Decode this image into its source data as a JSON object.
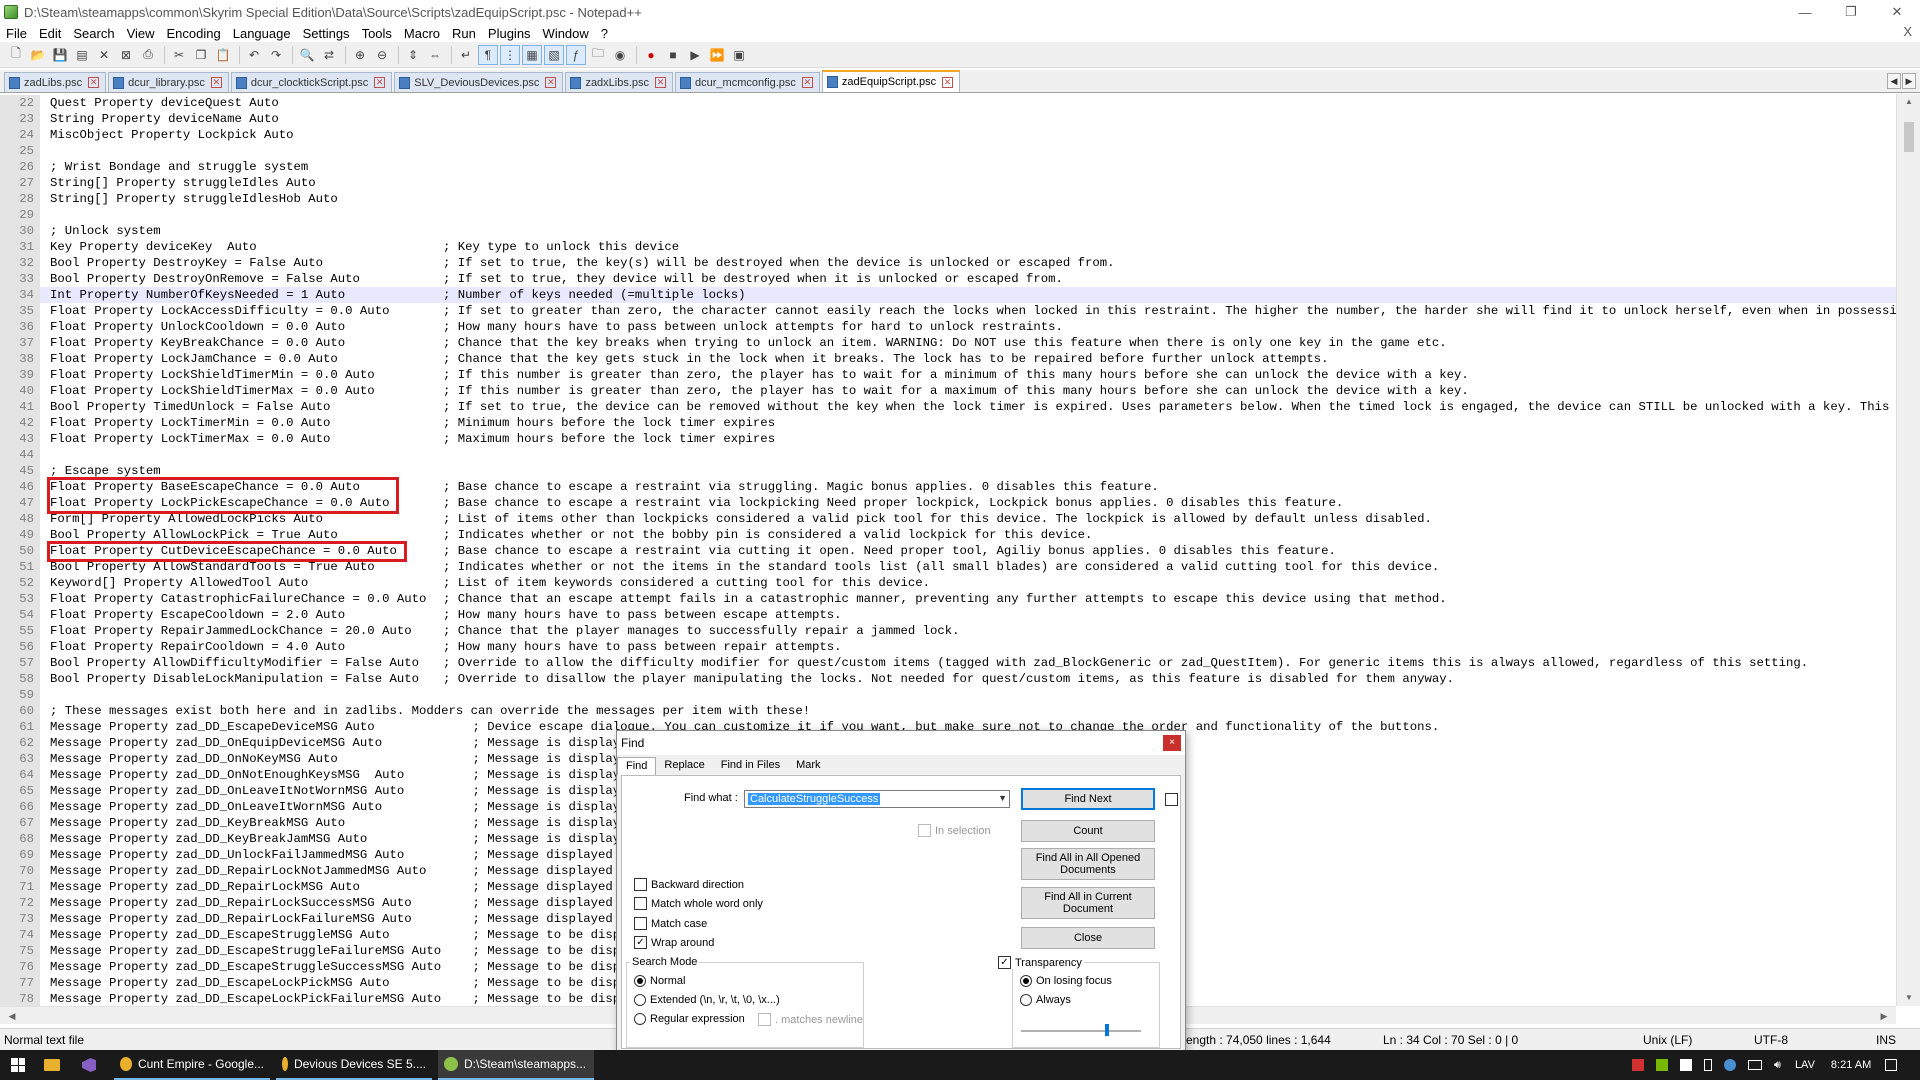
{
  "window": {
    "title": "D:\\Steam\\steamapps\\common\\Skyrim Special Edition\\Data\\Source\\Scripts\\zadEquipScript.psc - Notepad++",
    "minimize": "—",
    "restore": "❐",
    "close": "✕"
  },
  "menu": [
    "File",
    "Edit",
    "Search",
    "View",
    "Encoding",
    "Language",
    "Settings",
    "Tools",
    "Macro",
    "Run",
    "Plugins",
    "Window",
    "?"
  ],
  "menu_close": "X",
  "toolbar_icons": [
    "new-file-icon",
    "open-file-icon",
    "save-icon",
    "save-all-icon",
    "close-icon",
    "close-all-icon",
    "print-icon",
    "cut-icon",
    "copy-icon",
    "paste-icon",
    "undo-icon",
    "redo-icon",
    "find-icon",
    "replace-icon",
    "zoom-in-icon",
    "zoom-out-icon",
    "sync-vertical-icon",
    "sync-horizontal-icon",
    "word-wrap-icon",
    "show-all-chars-icon",
    "indent-guide-icon",
    "udl-icon",
    "doc-map-icon",
    "function-list-icon",
    "folder-workspace-icon",
    "monitoring-icon",
    "record-macro-icon",
    "stop-macro-icon",
    "play-macro-icon",
    "run-macro-multiple-icon",
    "save-macro-icon"
  ],
  "tabs": [
    {
      "label": "zadLibs.psc",
      "active": false
    },
    {
      "label": "dcur_library.psc",
      "active": false
    },
    {
      "label": "dcur_clocktickScript.psc",
      "active": false
    },
    {
      "label": "SLV_DeviousDevices.psc",
      "active": false
    },
    {
      "label": "zadxLibs.psc",
      "active": false
    },
    {
      "label": "dcur_mcmconfig.psc",
      "active": false
    },
    {
      "label": "zadEquipScript.psc",
      "active": true
    }
  ],
  "code_lines": [
    {
      "n": "22",
      "code": "Quest Property deviceQuest Auto",
      "comment": ""
    },
    {
      "n": "23",
      "code": "String Property deviceName Auto",
      "comment": ""
    },
    {
      "n": "24",
      "code": "MiscObject Property Lockpick Auto",
      "comment": ""
    },
    {
      "n": "25",
      "code": "",
      "comment": ""
    },
    {
      "n": "26",
      "code": "; Wrist Bondage and struggle system",
      "comment": ""
    },
    {
      "n": "27",
      "code": "String[] Property struggleIdles Auto",
      "comment": ""
    },
    {
      "n": "28",
      "code": "String[] Property struggleIdlesHob Auto",
      "comment": ""
    },
    {
      "n": "29",
      "code": "",
      "comment": ""
    },
    {
      "n": "30",
      "code": "; Unlock system",
      "comment": ""
    },
    {
      "n": "31",
      "code": "Key Property deviceKey  Auto",
      "comment": "; Key type to unlock this device"
    },
    {
      "n": "32",
      "code": "Bool Property DestroyKey = False Auto",
      "comment": "; If set to true, the key(s) will be destroyed when the device is unlocked or escaped from."
    },
    {
      "n": "33",
      "code": "Bool Property DestroyOnRemove = False Auto",
      "comment": "; If set to true, they device will be destroyed when it is unlocked or escaped from."
    },
    {
      "n": "34",
      "code": "Int Property NumberOfKeysNeeded = 1 Auto",
      "comment": "; Number of keys needed (=multiple locks)"
    },
    {
      "n": "35",
      "code": "Float Property LockAccessDifficulty = 0.0 Auto",
      "comment": "; If set to greater than zero, the character cannot easily reach the locks when locked in this restraint. The higher the number, the harder she will find it to unlock herself, even when in possession of the"
    },
    {
      "n": "36",
      "code": "Float Property UnlockCooldown = 0.0 Auto",
      "comment": "; How many hours have to pass between unlock attempts for hard to unlock restraints."
    },
    {
      "n": "37",
      "code": "Float Property KeyBreakChance = 0.0 Auto",
      "comment": "; Chance that the key breaks when trying to unlock an item. WARNING: Do NOT use this feature when there is only one key in the game etc."
    },
    {
      "n": "38",
      "code": "Float Property LockJamChance = 0.0 Auto",
      "comment": "; Chance that the key gets stuck in the lock when it breaks. The lock has to be repaired before further unlock attempts."
    },
    {
      "n": "39",
      "code": "Float Property LockShieldTimerMin = 0.0 Auto",
      "comment": "; If this number is greater than zero, the player has to wait for a minimum of this many hours before she can unlock the device with a key."
    },
    {
      "n": "40",
      "code": "Float Property LockShieldTimerMax = 0.0 Auto",
      "comment": "; If this number is greater than zero, the player has to wait for a maximum of this many hours before she can unlock the device with a key."
    },
    {
      "n": "41",
      "code": "Bool Property TimedUnlock = False Auto",
      "comment": "; If set to true, the device can be removed without the key when the lock timer is expired. Uses parameters below. When the timed lock is engaged, the device can STILL be unlocked with a key. This way, restr"
    },
    {
      "n": "42",
      "code": "Float Property LockTimerMin = 0.0 Auto",
      "comment": "; Minimum hours before the lock timer expires"
    },
    {
      "n": "43",
      "code": "Float Property LockTimerMax = 0.0 Auto",
      "comment": "; Maximum hours before the lock timer expires"
    },
    {
      "n": "44",
      "code": "",
      "comment": ""
    },
    {
      "n": "45",
      "code": "; Escape system",
      "comment": ""
    },
    {
      "n": "46",
      "code": "Float Property BaseEscapeChance = 0.0 Auto",
      "comment": "; Base chance to escape a restraint via struggling. Magic bonus applies. 0 disables this feature."
    },
    {
      "n": "47",
      "code": "Float Property LockPickEscapeChance = 0.0 Auto",
      "comment": "; Base chance to escape a restraint via lockpicking Need proper lockpick, Lockpick bonus applies. 0 disables this feature."
    },
    {
      "n": "48",
      "code": "Form[] Property AllowedLockPicks Auto",
      "comment": "; List of items other than lockpicks considered a valid pick tool for this device. The lockpick is allowed by default unless disabled."
    },
    {
      "n": "49",
      "code": "Bool Property AllowLockPick = True Auto",
      "comment": "; Indicates whether or not the bobby pin is considered a valid lockpick for this device."
    },
    {
      "n": "50",
      "code": "Float Property CutDeviceEscapeChance = 0.0 Auto",
      "comment": "; Base chance to escape a restraint via cutting it open. Need proper tool, Agiliy bonus applies. 0 disables this feature."
    },
    {
      "n": "51",
      "code": "Bool Property AllowStandardTools = True Auto",
      "comment": "; Indicates whether or not the items in the standard tools list (all small blades) are considered a valid cutting tool for this device."
    },
    {
      "n": "52",
      "code": "Keyword[] Property AllowedTool Auto",
      "comment": "; List of item keywords considered a cutting tool for this device."
    },
    {
      "n": "53",
      "code": "Float Property CatastrophicFailureChance = 0.0 Auto",
      "comment": "; Chance that an escape attempt fails in a catastrophic manner, preventing any further attempts to escape this device using that method."
    },
    {
      "n": "54",
      "code": "Float Property EscapeCooldown = 2.0 Auto",
      "comment": "; How many hours have to pass between escape attempts."
    },
    {
      "n": "55",
      "code": "Float Property RepairJammedLockChance = 20.0 Auto",
      "comment": "; Chance that the player manages to successfully repair a jammed lock."
    },
    {
      "n": "56",
      "code": "Float Property RepairCooldown = 4.0 Auto",
      "comment": "; How many hours have to pass between repair attempts."
    },
    {
      "n": "57",
      "code": "Bool Property AllowDifficultyModifier = False Auto",
      "comment": "; Override to allow the difficulty modifier for quest/custom items (tagged with zad_BlockGeneric or zad_QuestItem). For generic items this is always allowed, regardless of this setting."
    },
    {
      "n": "58",
      "code": "Bool Property DisableLockManipulation = False Auto",
      "comment": "; Override to disallow the player manipulating the locks. Not needed for quest/custom items, as this feature is disabled for them anyway."
    },
    {
      "n": "59",
      "code": "",
      "comment": ""
    },
    {
      "n": "60",
      "code": "; These messages exist both here and in zadlibs. Modders can override the messages per item with these!",
      "comment": ""
    },
    {
      "n": "61",
      "code": "Message Property zad_DD_EscapeDeviceMSG Auto",
      "comment": "    ; Device escape dialogue. You can customize it if you want, but make sure not to change the order and functionality of the buttons."
    },
    {
      "n": "62",
      "code": "Message Property zad_DD_OnEquipDeviceMSG Auto",
      "comment": "    ; Message is displayed"
    },
    {
      "n": "63",
      "code": "Message Property zad_DD_OnNoKeyMSG Auto",
      "comment": "    ; Message is displaye"
    },
    {
      "n": "64",
      "code": "Message Property zad_DD_OnNotEnoughKeysMSG  Auto",
      "comment": "    ; Message is displaye"
    },
    {
      "n": "65",
      "code": "Message Property zad_DD_OnLeaveItNotWornMSG Auto",
      "comment": "    ; Message is displaye"
    },
    {
      "n": "66",
      "code": "Message Property zad_DD_OnLeaveItWornMSG Auto",
      "comment": "    ; Message is displaye"
    },
    {
      "n": "67",
      "code": "Message Property zad_DD_KeyBreakMSG Auto",
      "comment": "    ; Message is displaye"
    },
    {
      "n": "68",
      "code": "Message Property zad_DD_KeyBreakJamMSG Auto",
      "comment": "    ; Message is displaye"
    },
    {
      "n": "69",
      "code": "Message Property zad_DD_UnlockFailJammedMSG Auto",
      "comment": "    ; Message displayed w"
    },
    {
      "n": "70",
      "code": "Message Property zad_DD_RepairLockNotJammedMSG Auto",
      "comment": "    ; Message displayed w"
    },
    {
      "n": "71",
      "code": "Message Property zad_DD_RepairLockMSG Auto",
      "comment": "    ; Message displayed w"
    },
    {
      "n": "72",
      "code": "Message Property zad_DD_RepairLockSuccessMSG Auto",
      "comment": "    ; Message displayed w"
    },
    {
      "n": "73",
      "code": "Message Property zad_DD_RepairLockFailureMSG Auto",
      "comment": "    ; Message displayed w"
    },
    {
      "n": "74",
      "code": "Message Property zad_DD_EscapeStruggleMSG Auto",
      "comment": "    ; Message to be displ"
    },
    {
      "n": "75",
      "code": "Message Property zad_DD_EscapeStruggleFailureMSG Auto",
      "comment": "    ; Message to be displ"
    },
    {
      "n": "76",
      "code": "Message Property zad_DD_EscapeStruggleSuccessMSG Auto",
      "comment": "    ; Message to be displ"
    },
    {
      "n": "77",
      "code": "Message Property zad_DD_EscapeLockPickMSG Auto",
      "comment": "    ; Message to be displ"
    },
    {
      "n": "78",
      "code": "Message Property zad_DD_EscapeLockPickFailureMSG Auto",
      "comment": "    ; Message to be displ"
    }
  ],
  "current_line": "34",
  "highlighted_lines": [
    "46-47",
    "50"
  ],
  "find_dialog": {
    "title": "Find",
    "close": "×",
    "tabs": [
      "Find",
      "Replace",
      "Find in Files",
      "Mark"
    ],
    "find_what_label": "Find what :",
    "find_what_value": "CalculateStruggleSuccess",
    "in_selection": "In selection",
    "buttons": {
      "find_next": "Find Next",
      "count": "Count",
      "find_all_opened": "Find All in All Opened Documents",
      "find_all_current": "Find All in Current Document",
      "close": "Close"
    },
    "options": {
      "backward": "Backward direction",
      "whole_word": "Match whole word only",
      "match_case": "Match case",
      "wrap_around": "Wrap around"
    },
    "search_mode_label": "Search Mode",
    "modes": {
      "normal": "Normal",
      "extended": "Extended (\\n, \\r, \\t, \\0, \\x...)",
      "regex": "Regular expression",
      "matches_newline": ". matches newline"
    },
    "transparency": "Transparency",
    "on_losing_focus": "On losing focus",
    "always": "Always",
    "transparency_level": 0.7
  },
  "status": {
    "file_type": "Normal text file",
    "length": "ength : 74,050    lines : 1,644",
    "position": "Ln : 34    Col : 70    Sel : 0 | 0",
    "eol": "Unix (LF)",
    "encoding": "UTF-8",
    "mode": "INS"
  },
  "taskbar": {
    "apps": [
      {
        "label": "Cunt Empire - Google...",
        "icon_color": "#e8b02d"
      },
      {
        "label": "Devious Devices SE 5....",
        "icon_color": "#e8b02d"
      },
      {
        "label": "D:\\Steam\\steamapps...",
        "icon_color": "#8bc34a"
      }
    ],
    "language": "LAV",
    "time": "8:21 AM"
  }
}
